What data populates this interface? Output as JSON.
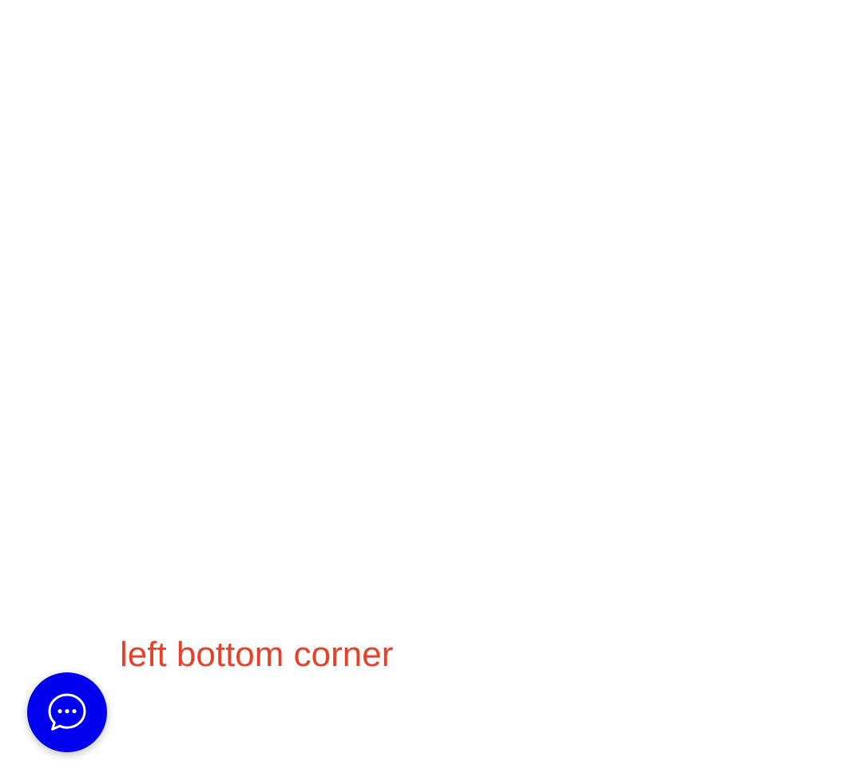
{
  "label": {
    "text": "left bottom corner",
    "color": "#e8412a"
  },
  "chat_launcher": {
    "icon": "chat-bubble-ellipsis-icon",
    "background_color": "#0000ee",
    "icon_color": "#ffffff"
  }
}
